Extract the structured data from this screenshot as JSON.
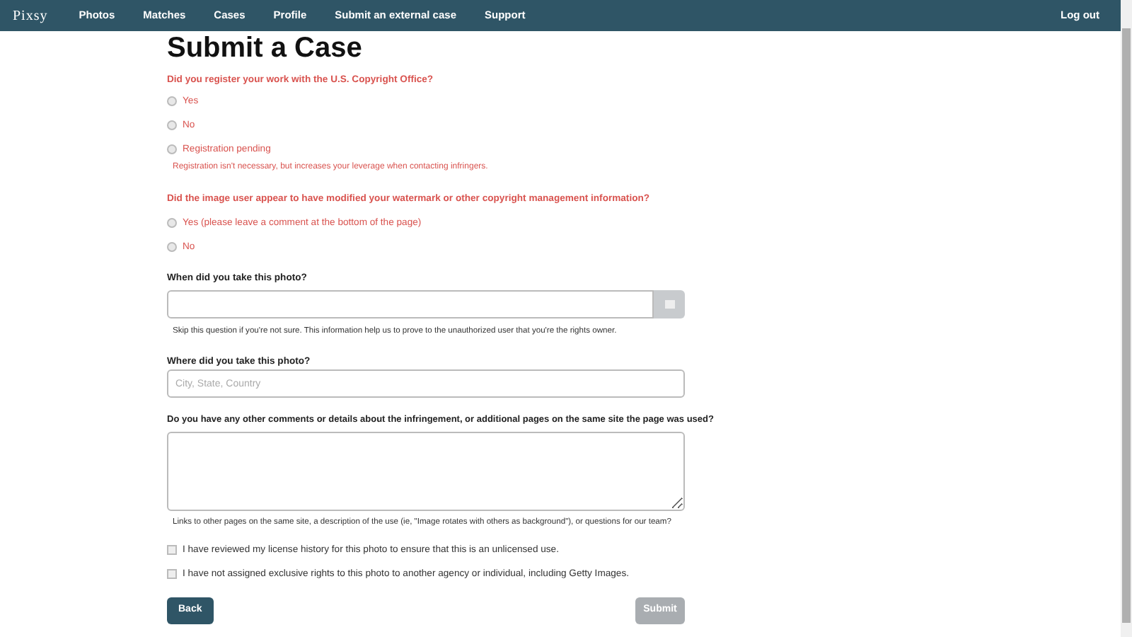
{
  "nav": {
    "logo": "Pixsy",
    "items": [
      {
        "label": "Photos"
      },
      {
        "label": "Matches"
      },
      {
        "label": "Cases"
      },
      {
        "label": "Profile"
      },
      {
        "label": "Submit an external case"
      },
      {
        "label": "Support"
      }
    ],
    "logout": "Log out"
  },
  "title": "Submit a Case",
  "q1": {
    "label": "Did you register your work with the U.S. Copyright Office?",
    "options": [
      {
        "label": "Yes",
        "selected": false
      },
      {
        "label": "No",
        "selected": false
      },
      {
        "label": "Registration pending",
        "selected": false
      }
    ],
    "note": "Registration isn't necessary, but increases your leverage when contacting infringers."
  },
  "q2": {
    "label": "Did the image user appear to have modified your watermark or other copyright management information?",
    "options": [
      {
        "label": "Yes (please leave a comment at the bottom of the page)",
        "selected": false
      },
      {
        "label": "No",
        "selected": false
      }
    ]
  },
  "date": {
    "label": "When did you take this photo?",
    "help": "Skip this question if you're not sure. This information help us to prove to the unauthorized user that you're the rights owner."
  },
  "place": {
    "label": "Where did you take this photo?",
    "placeholder": "City, State, Country"
  },
  "comments": {
    "label": "Do you have any other comments or details about the infringement, or additional pages on the same site the page was used?",
    "help": "Links to other pages on the same site, a description of the use (ie, \"Image rotates with others as background\"), or questions for our team?"
  },
  "checks": [
    {
      "label": "I have reviewed my license history for this photo to ensure that this is an unlicensed use.",
      "checked": false
    },
    {
      "label": "I have not assigned exclusive rights to this photo to another agency or individual, including Getty Images.",
      "checked": false
    }
  ],
  "back": "Back",
  "submit": {
    "label": "Submit",
    "disabled": true
  }
}
